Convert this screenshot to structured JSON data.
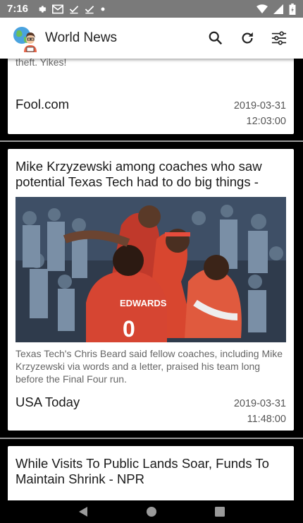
{
  "status_bar": {
    "time": "7:16",
    "left_icons": [
      "gear-icon",
      "gmail-icon",
      "check-icon",
      "check-icon",
      "dot-icon"
    ],
    "right_icons": [
      "wifi-icon",
      "signal-icon",
      "battery-icon"
    ]
  },
  "app_bar": {
    "title": "World News",
    "actions": [
      "search-icon",
      "refresh-icon",
      "filter-icon"
    ]
  },
  "articles": [
    {
      "description": "Social Security mistakes can be costly, leaving you with smaller benefit checks or possibly having to deal with identity theft. Yikes!",
      "source": "Fool.com",
      "date": "2019-03-31",
      "time": "12:03:00"
    },
    {
      "title": "Mike Krzyzewski among coaches who saw potential Texas Tech had to do big things -",
      "image_jersey_name": "EDWARDS",
      "image_jersey_number": "0",
      "description": "Texas Tech's Chris Beard said fellow coaches, including Mike Krzyzewski via words and a letter, praised his team long before the Final Four run.",
      "source": "USA Today",
      "date": "2019-03-31",
      "time": "11:48:00"
    },
    {
      "title": "While Visits To Public Lands Soar, Funds To Maintain Shrink - NPR"
    }
  ],
  "nav_bar": [
    "back-icon",
    "home-icon",
    "recents-icon"
  ]
}
